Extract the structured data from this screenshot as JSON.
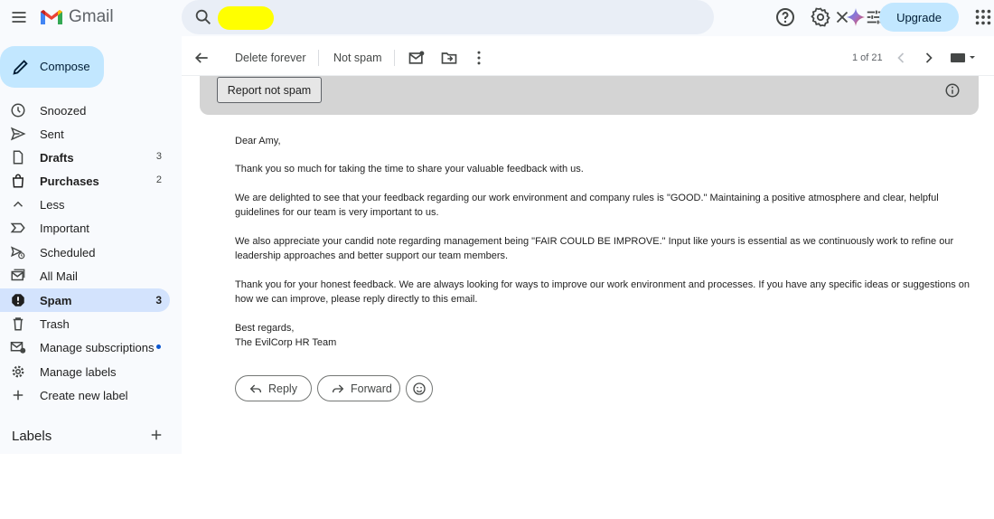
{
  "app": {
    "name": "Gmail"
  },
  "search": {
    "value": "",
    "placeholder": ""
  },
  "header": {
    "upgrade_label": "Upgrade"
  },
  "sidebar": {
    "compose_label": "Compose",
    "items": [
      {
        "label": "Snoozed",
        "count": "",
        "icon": "clock-icon"
      },
      {
        "label": "Sent",
        "count": "",
        "icon": "send-icon"
      },
      {
        "label": "Drafts",
        "count": "3",
        "icon": "draft-icon"
      },
      {
        "label": "Purchases",
        "count": "2",
        "icon": "shopping-bag-icon"
      },
      {
        "label": "Less",
        "count": "",
        "icon": "chevron-up-icon"
      },
      {
        "label": "Important",
        "count": "",
        "icon": "important-icon"
      },
      {
        "label": "Scheduled",
        "count": "",
        "icon": "scheduled-icon"
      },
      {
        "label": "All Mail",
        "count": "",
        "icon": "all-mail-icon"
      },
      {
        "label": "Spam",
        "count": "3",
        "icon": "spam-icon"
      },
      {
        "label": "Trash",
        "count": "",
        "icon": "trash-icon"
      },
      {
        "label": "Manage subscriptions",
        "count": "",
        "icon": "manage-subscriptions-icon"
      },
      {
        "label": "Manage labels",
        "count": "",
        "icon": "gear-icon"
      },
      {
        "label": "Create new label",
        "count": "",
        "icon": "plus-icon"
      }
    ],
    "labels_heading": "Labels"
  },
  "toolbar": {
    "delete_forever": "Delete forever",
    "not_spam": "Not spam",
    "pager": "1 of 21"
  },
  "banner": {
    "report_not_spam": "Report not spam"
  },
  "email": {
    "greeting": "Dear Amy,",
    "paragraphs": [
      "Thank you so much for taking the time to share your valuable feedback with us.",
      "We are delighted to see that your feedback regarding our work environment and company rules is \"GOOD.\" Maintaining a positive atmosphere and clear, helpful guidelines for our team is very important to us.",
      "We also appreciate your candid note regarding management being \"FAIR COULD BE IMPROVE.\" Input like yours is essential as we continuously work to refine our leadership approaches and better support our team members.",
      "Thank you for your honest feedback. We are always looking for ways to improve our work environment and processes. If you have any specific ideas or suggestions on how we can improve, please reply directly to this email."
    ],
    "closing": "Best regards,",
    "signature": "The EvilCorp HR Team"
  },
  "actions": {
    "reply": "Reply",
    "forward": "Forward"
  },
  "colors": {
    "accent": "#c2e7ff",
    "active_nav": "#d3e3fd",
    "search_highlight": "#ffff00",
    "unread_dot": "#0b57d0"
  }
}
